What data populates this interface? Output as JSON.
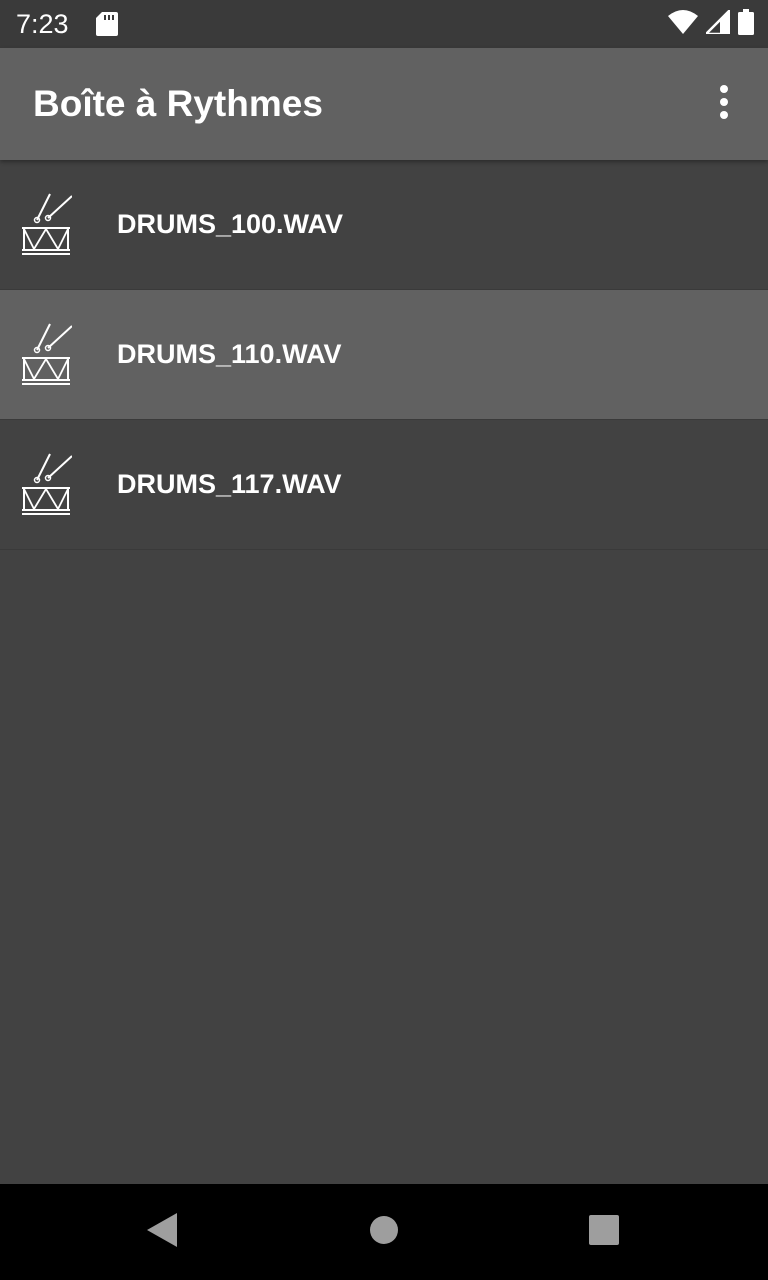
{
  "status_bar": {
    "time": "7:23",
    "icons": [
      "sd-card-icon",
      "wifi-icon",
      "signal-icon",
      "battery-icon"
    ]
  },
  "app_bar": {
    "title": "Boîte à Rythmes",
    "overflow_icon": "more-vert-icon"
  },
  "list": {
    "items": [
      {
        "label": "DRUMS_100.WAV",
        "icon": "drum-icon",
        "selected": false
      },
      {
        "label": "DRUMS_110.WAV",
        "icon": "drum-icon",
        "selected": true
      },
      {
        "label": "DRUMS_117.WAV",
        "icon": "drum-icon",
        "selected": false
      }
    ]
  },
  "nav_bar": {
    "buttons": [
      "back-icon",
      "home-icon",
      "recents-icon"
    ]
  },
  "colors": {
    "background": "#424242",
    "app_bar": "#616161",
    "status_bar": "#3a3a3a",
    "selected_row": "#616161",
    "nav_bar": "#000000",
    "text": "#ffffff"
  }
}
